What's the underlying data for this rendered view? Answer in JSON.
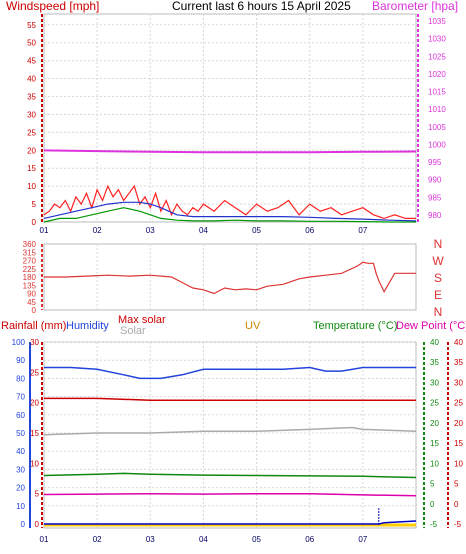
{
  "title": "Current last 6 hours 15 April 2025",
  "colors": {
    "wind": "#cc0000",
    "gust": "#ff2222",
    "avg_wind": "#2233cc",
    "wind_green": "#009900",
    "baro": "#dd33dd",
    "dir": "#dd3333",
    "rain": "#0000cc",
    "humidity": "#2244dd",
    "solar": "#aaaaaa",
    "maxsolar": "#cc0000",
    "uv": "#cc8800",
    "temp": "#118811",
    "dew": "#dd00aa",
    "grid": "#d8d8d8"
  },
  "chart_data": [
    {
      "type": "line",
      "name": "wind-baro",
      "x_labels": [
        "01",
        "02",
        "03",
        "04",
        "05",
        "06",
        "07"
      ],
      "left_axis": {
        "title": "Windspeed [mph]",
        "ylim": [
          0,
          58
        ],
        "ticks": [
          0,
          5,
          10,
          15,
          20,
          25,
          30,
          35,
          40,
          45,
          50,
          55
        ]
      },
      "right_axis": {
        "title": "Barometer [hpa]",
        "ylim": [
          978,
          1037
        ],
        "ticks": [
          980,
          985,
          990,
          995,
          1000,
          1005,
          1010,
          1015,
          1020,
          1025,
          1030,
          1035
        ]
      },
      "series": [
        {
          "key": "gust",
          "color_key": "gust",
          "axis": "left",
          "x": [
            0.0,
            0.1,
            0.2,
            0.3,
            0.4,
            0.5,
            0.6,
            0.7,
            0.8,
            0.9,
            1.0,
            1.1,
            1.2,
            1.3,
            1.4,
            1.5,
            1.6,
            1.7,
            1.8,
            1.9,
            2.0,
            2.1,
            2.2,
            2.3,
            2.4,
            2.5,
            2.6,
            2.7,
            2.8,
            2.9,
            3.0,
            3.2,
            3.4,
            3.6,
            3.8,
            4.0,
            4.2,
            4.4,
            4.6,
            4.8,
            5.0,
            5.2,
            5.4,
            5.6,
            5.8,
            6.0,
            6.2,
            6.4,
            6.6,
            6.8,
            7.0
          ],
          "y": [
            2,
            3,
            5,
            4,
            6,
            3,
            7,
            5,
            8,
            4,
            9,
            6,
            10,
            7,
            9,
            6,
            8,
            10,
            5,
            7,
            4,
            8,
            3,
            6,
            2,
            5,
            3,
            2,
            4,
            3,
            5,
            3,
            6,
            4,
            2,
            5,
            3,
            4,
            6,
            2,
            5,
            3,
            4,
            2,
            3,
            4,
            2,
            1,
            2,
            1,
            1
          ]
        },
        {
          "key": "avg_wind",
          "color_key": "avg_wind",
          "axis": "left",
          "x": [
            0.0,
            0.3,
            0.6,
            0.9,
            1.2,
            1.5,
            1.8,
            2.0,
            2.2,
            2.5,
            2.8,
            3.2,
            3.6,
            4.0,
            4.5,
            5.0,
            5.5,
            6.0,
            6.5,
            7.0
          ],
          "y": [
            1,
            2,
            3,
            4,
            5,
            5.5,
            5.5,
            5,
            4,
            2,
            1.5,
            1.5,
            1.5,
            1.5,
            1.5,
            1.3,
            1,
            0.8,
            0.5,
            0.3
          ]
        },
        {
          "key": "wind_green",
          "color_key": "wind_green",
          "axis": "left",
          "x": [
            0.0,
            0.3,
            0.6,
            0.9,
            1.2,
            1.5,
            1.8,
            2.0,
            2.2,
            2.5,
            2.8,
            3.2,
            3.6,
            4.0,
            4.5,
            5.0,
            5.5,
            6.0,
            6.5,
            7.0
          ],
          "y": [
            0,
            1,
            1,
            2,
            3,
            4,
            3,
            2,
            1,
            0.5,
            0.3,
            0.3,
            0.5,
            0.3,
            0.3,
            0.2,
            0.2,
            0.1,
            0,
            0
          ]
        },
        {
          "key": "baro",
          "color_key": "baro",
          "axis": "right",
          "x": [
            0,
            1,
            2,
            3,
            4,
            5,
            6,
            7
          ],
          "y": [
            998.3,
            998.1,
            997.9,
            997.8,
            997.8,
            997.8,
            997.9,
            998.0
          ]
        }
      ]
    },
    {
      "type": "line",
      "name": "wind-direction",
      "x_labels": [
        "01",
        "02",
        "03",
        "04",
        "05",
        "06",
        "07"
      ],
      "ylim": [
        0,
        360
      ],
      "ticks": [
        0,
        45,
        90,
        135,
        180,
        225,
        270,
        315,
        360
      ],
      "compass": [
        "N",
        "W",
        "S",
        "E",
        "N"
      ],
      "series": [
        {
          "key": "direction",
          "color_key": "dir",
          "x": [
            0.0,
            0.4,
            0.8,
            1.2,
            1.6,
            2.0,
            2.4,
            2.6,
            2.8,
            3.0,
            3.2,
            3.4,
            3.6,
            3.8,
            4.0,
            4.2,
            4.5,
            4.8,
            5.0,
            5.3,
            5.6,
            5.9,
            6.0,
            6.1,
            6.2,
            6.25,
            6.3,
            6.4,
            6.6,
            6.8,
            7.0
          ],
          "y": [
            180,
            180,
            185,
            190,
            185,
            190,
            180,
            150,
            120,
            110,
            90,
            120,
            110,
            115,
            110,
            130,
            140,
            170,
            180,
            190,
            200,
            240,
            260,
            255,
            255,
            200,
            160,
            100,
            200,
            200,
            200
          ]
        }
      ]
    },
    {
      "type": "line",
      "name": "rain-humidity-temp",
      "x_labels": [
        "01",
        "02",
        "03",
        "04",
        "05",
        "06",
        "07"
      ],
      "legend": [
        "Rainfall (mm)",
        "Humidity",
        "Max solar",
        "Solar",
        "UV",
        "Temperature (°C)",
        "Dew Point (°C)"
      ],
      "humidity_axis": {
        "ylim": [
          0,
          100
        ],
        "ticks": [
          0,
          10,
          20,
          30,
          40,
          50,
          60,
          70,
          80,
          90,
          100
        ]
      },
      "rain_axis": {
        "ylim": [
          0,
          30
        ],
        "ticks": [
          0,
          5,
          10,
          15,
          20,
          25,
          30
        ]
      },
      "temp_axis": {
        "ylim": [
          -5,
          40
        ],
        "ticks": [
          -5,
          0,
          5,
          10,
          15,
          20,
          25,
          30,
          35,
          40
        ]
      },
      "series": [
        {
          "key": "humidity",
          "color_key": "humidity",
          "axis": "humidity",
          "x": [
            0,
            0.5,
            1,
            1.5,
            1.8,
            2.2,
            2.6,
            3,
            3.5,
            4,
            4.5,
            5,
            5.3,
            5.6,
            6,
            6.5,
            7
          ],
          "y": [
            86,
            86,
            85,
            82,
            80,
            80,
            82,
            85,
            85,
            85,
            85,
            86,
            84,
            84,
            86,
            86,
            86
          ]
        },
        {
          "key": "maxsolar",
          "color_key": "maxsolar",
          "axis": "humidity",
          "x": [
            0,
            1,
            2,
            3,
            4,
            5,
            6,
            7
          ],
          "y": [
            69,
            69,
            68,
            68,
            68,
            68,
            68,
            68
          ]
        },
        {
          "key": "solar",
          "color_key": "solar",
          "axis": "humidity",
          "x": [
            0,
            1,
            2,
            3,
            4,
            5,
            5.8,
            6,
            7
          ],
          "y": [
            49,
            50,
            50,
            51,
            51,
            52,
            53,
            52,
            51
          ]
        },
        {
          "key": "temp",
          "color_key": "temp",
          "axis": "temp",
          "x": [
            0,
            1,
            1.5,
            2,
            3,
            4,
            5,
            6,
            7
          ],
          "y": [
            7,
            7.3,
            7.5,
            7.3,
            7.1,
            7,
            6.9,
            6.8,
            6.5
          ]
        },
        {
          "key": "dew",
          "color_key": "dew",
          "axis": "temp",
          "x": [
            0,
            1,
            2,
            3,
            4,
            5,
            6,
            7
          ],
          "y": [
            2.3,
            2.4,
            2.5,
            2.4,
            2.5,
            2.5,
            2.2,
            2.0
          ]
        },
        {
          "key": "rain",
          "color_key": "rain",
          "axis": "rain",
          "x": [
            0,
            1,
            2,
            3,
            4,
            5,
            6,
            6.3,
            6.4,
            7
          ],
          "y": [
            0,
            0,
            0,
            0,
            0,
            0,
            0,
            0,
            0.2,
            0.5
          ]
        }
      ]
    }
  ]
}
